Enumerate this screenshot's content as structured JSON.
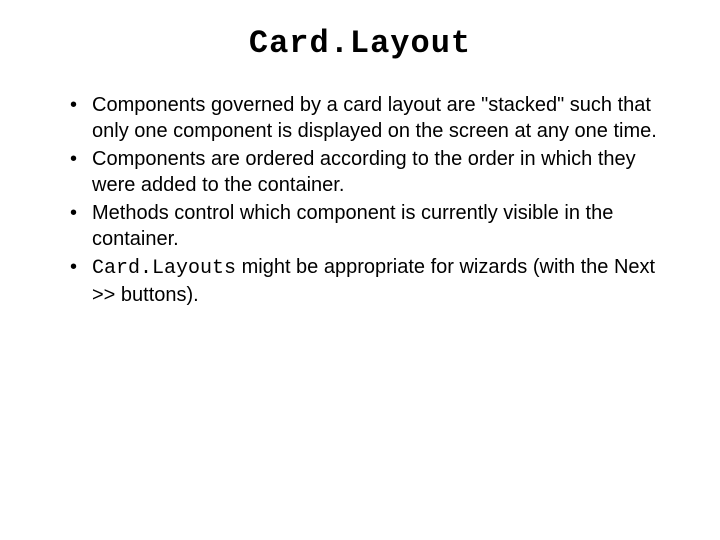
{
  "title": "Card.Layout",
  "bullets": [
    {
      "text": "Components governed by a card layout are \"stacked\" such that only one component is displayed on the screen at any one time."
    },
    {
      "text": "Components are ordered according to the order in which they were added to the container."
    },
    {
      "text": "Methods control which component is currently visible in the container."
    },
    {
      "mono_prefix": "Card.Layouts",
      "text_suffix": " might be appropriate for wizards (with the Next >> buttons)."
    }
  ]
}
